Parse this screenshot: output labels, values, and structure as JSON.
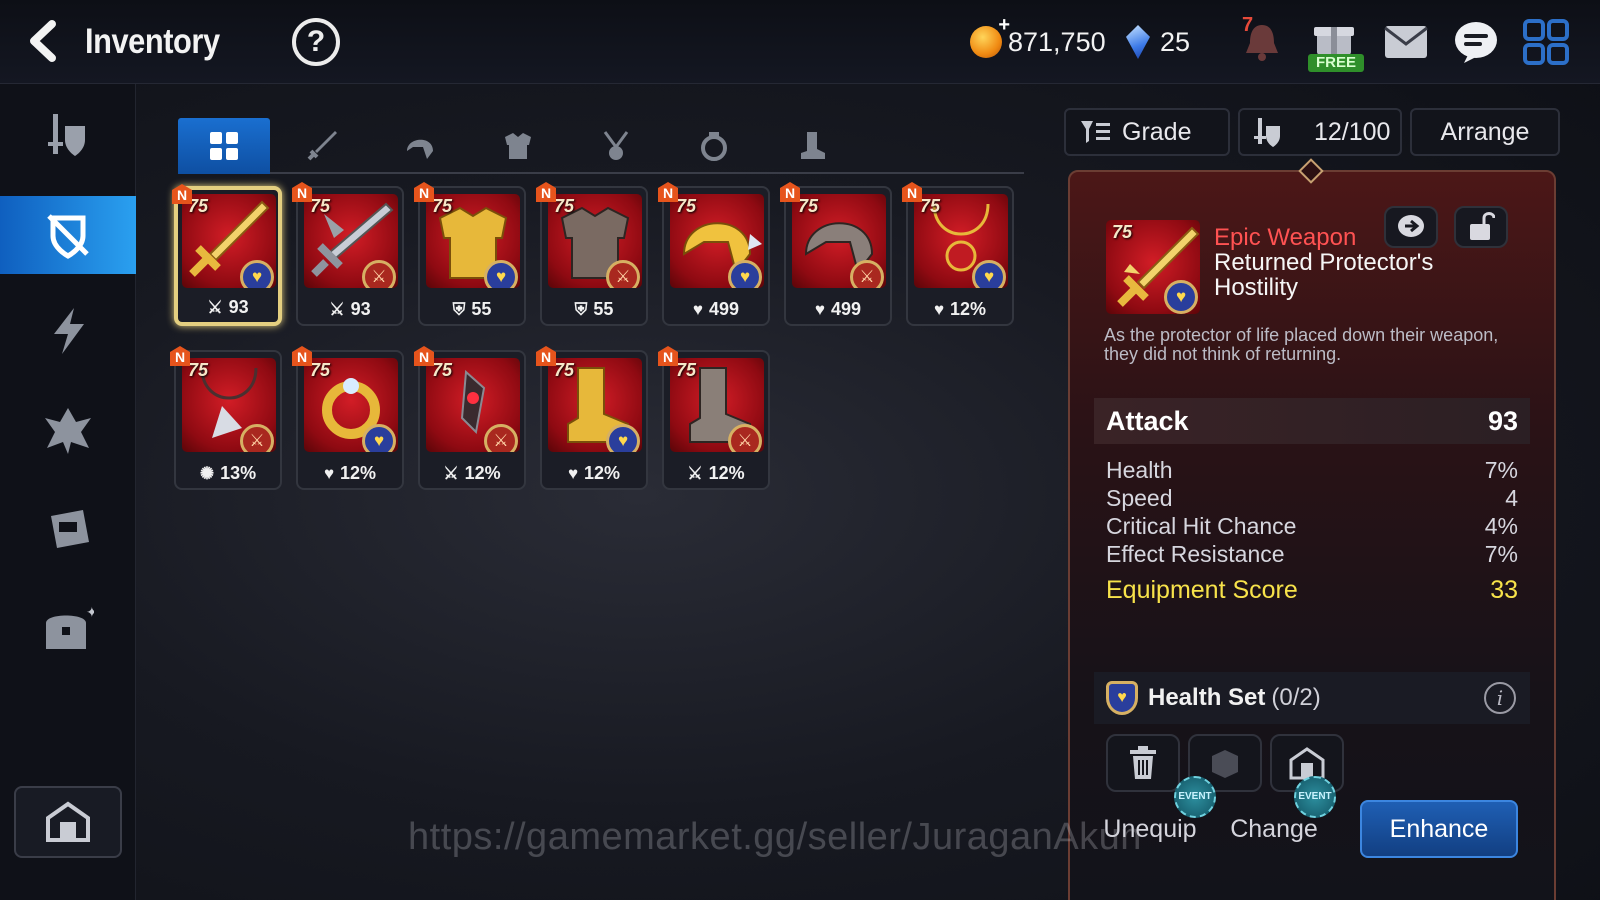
{
  "header": {
    "title": "Inventory",
    "help": "?",
    "gold": "871,750",
    "gems": "25",
    "notification_count": "7",
    "free_label": "FREE"
  },
  "sidebar": {
    "items": [
      {
        "name": "sidebar-item-equip",
        "icon": "sword-shield-icon"
      },
      {
        "name": "sidebar-item-equipment",
        "icon": "shield-slash-icon",
        "active": true
      },
      {
        "name": "sidebar-item-artifacts",
        "icon": "lightning-icon"
      },
      {
        "name": "sidebar-item-catalysts",
        "icon": "crystal-icon"
      },
      {
        "name": "sidebar-item-materials",
        "icon": "bag-icon"
      },
      {
        "name": "sidebar-item-chests",
        "icon": "chest-icon"
      }
    ],
    "bottom_icon": "storage-icon"
  },
  "tabs": [
    {
      "name": "tab-all",
      "icon": "grid-icon",
      "active": true
    },
    {
      "name": "tab-weapon",
      "icon": "sword-icon"
    },
    {
      "name": "tab-helmet",
      "icon": "helmet-icon"
    },
    {
      "name": "tab-armor",
      "icon": "armor-icon"
    },
    {
      "name": "tab-necklace",
      "icon": "necklace-icon"
    },
    {
      "name": "tab-ring",
      "icon": "ring-icon"
    },
    {
      "name": "tab-boots",
      "icon": "boots-icon"
    }
  ],
  "items": [
    {
      "level": "75",
      "badge": "N",
      "set": "health",
      "stat_icon": "attack-icon",
      "stat": "93",
      "art": "sword",
      "selected": true
    },
    {
      "level": "75",
      "badge": "N",
      "set": "attack",
      "stat_icon": "attack-icon",
      "stat": "93",
      "art": "sword2"
    },
    {
      "level": "75",
      "badge": "N",
      "set": "health",
      "stat_icon": "defense-icon",
      "stat": "55",
      "art": "armor-gold"
    },
    {
      "level": "75",
      "badge": "N",
      "set": "attack",
      "stat_icon": "defense-icon",
      "stat": "55",
      "art": "armor-dark"
    },
    {
      "level": "75",
      "badge": "N",
      "set": "health",
      "stat_icon": "health-icon",
      "stat": "499",
      "art": "helmet-gold"
    },
    {
      "level": "75",
      "badge": "N",
      "set": "attack",
      "stat_icon": "health-icon",
      "stat": "499",
      "art": "helmet-dark"
    },
    {
      "level": "75",
      "badge": "N",
      "set": "health",
      "stat_icon": "health-icon",
      "stat": "12%",
      "art": "necklace-gold"
    },
    {
      "level": "75",
      "badge": "N",
      "set": "attack",
      "stat_icon": "crit-icon",
      "stat": "13%",
      "art": "necklace-dark"
    },
    {
      "level": "75",
      "badge": "N",
      "set": "health",
      "stat_icon": "health-icon",
      "stat": "12%",
      "art": "ring-gold"
    },
    {
      "level": "75",
      "badge": "N",
      "set": "attack",
      "stat_icon": "attack-icon",
      "stat": "12%",
      "art": "ring-dark"
    },
    {
      "level": "75",
      "badge": "N",
      "set": "health",
      "stat_icon": "health-icon",
      "stat": "12%",
      "art": "boots-gold"
    },
    {
      "level": "75",
      "badge": "N",
      "set": "attack",
      "stat_icon": "attack-icon",
      "stat": "12%",
      "art": "boots-dark"
    }
  ],
  "controls": {
    "grade_label": "Grade",
    "capacity": "12/100",
    "arrange_label": "Arrange"
  },
  "detail": {
    "level": "75",
    "grade": "Epic Weapon",
    "name": "Returned Protector's Hostility",
    "description": "As the protector of life placed down their weapon, they did not think of returning.",
    "main_stat": {
      "label": "Attack",
      "value": "93"
    },
    "sub_stats": [
      {
        "label": "Health",
        "value": "7%"
      },
      {
        "label": "Speed",
        "value": "4"
      },
      {
        "label": "Critical Hit Chance",
        "value": "4%"
      },
      {
        "label": "Effect Resistance",
        "value": "7%"
      }
    ],
    "score": {
      "label": "Equipment Score",
      "value": "33"
    },
    "set": {
      "name": "Health Set",
      "progress": "(0/2)"
    },
    "event_label": "EVENT",
    "unequip_label": "Unequip",
    "change_label": "Change",
    "enhance_label": "Enhance"
  },
  "watermark": "https://gamemarket.gg/seller/JuraganAkun",
  "colors": {
    "accent_blue": "#1a6fd0",
    "epic_red": "#ff5252",
    "score_yellow": "#f7e24a",
    "gold_border": "#e4cf80"
  }
}
